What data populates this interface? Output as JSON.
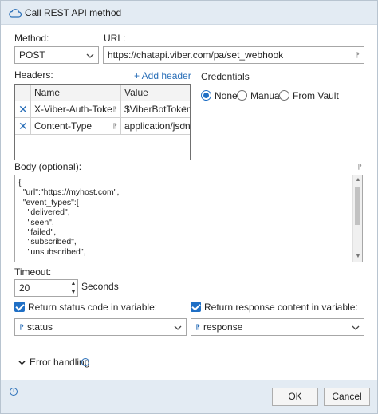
{
  "window": {
    "title": "Call REST API method"
  },
  "method": {
    "label": "Method:",
    "value": "POST"
  },
  "url": {
    "label": "URL:",
    "value": "https://chatapi.viber.com/pa/set_webhook"
  },
  "headers": {
    "label": "Headers:",
    "add_label": "+ Add header",
    "columns": [
      "Name",
      "Value"
    ],
    "rows": [
      {
        "name": "X-Viber-Auth-Toke",
        "value": "$ViberBotToken$"
      },
      {
        "name": "Content-Type",
        "value": "application/json"
      }
    ]
  },
  "credentials": {
    "label": "Credentials",
    "options": [
      "None",
      "Manual",
      "From Vault"
    ],
    "selected": "None"
  },
  "body": {
    "label": "Body (optional):",
    "text": "{\n  \"url\":\"https://myhost.com\",\n  \"event_types\":[\n    \"delivered\",\n    \"seen\",\n    \"failed\",\n    \"subscribed\",\n    \"unsubscribed\","
  },
  "timeout": {
    "label": "Timeout:",
    "value": "20",
    "unit": "Seconds"
  },
  "status_code": {
    "label": "Return status code in variable:",
    "checked": true,
    "variable": "status"
  },
  "response_content": {
    "label": "Return response content in variable:",
    "checked": true,
    "variable": "response"
  },
  "error_handling": {
    "label": "Error handling"
  },
  "footer": {
    "ok_label": "OK",
    "cancel_label": "Cancel"
  },
  "colors": {
    "accent": "#1f6fc5",
    "titlebar": "#e3ebf3",
    "link": "#2a6fb8"
  }
}
